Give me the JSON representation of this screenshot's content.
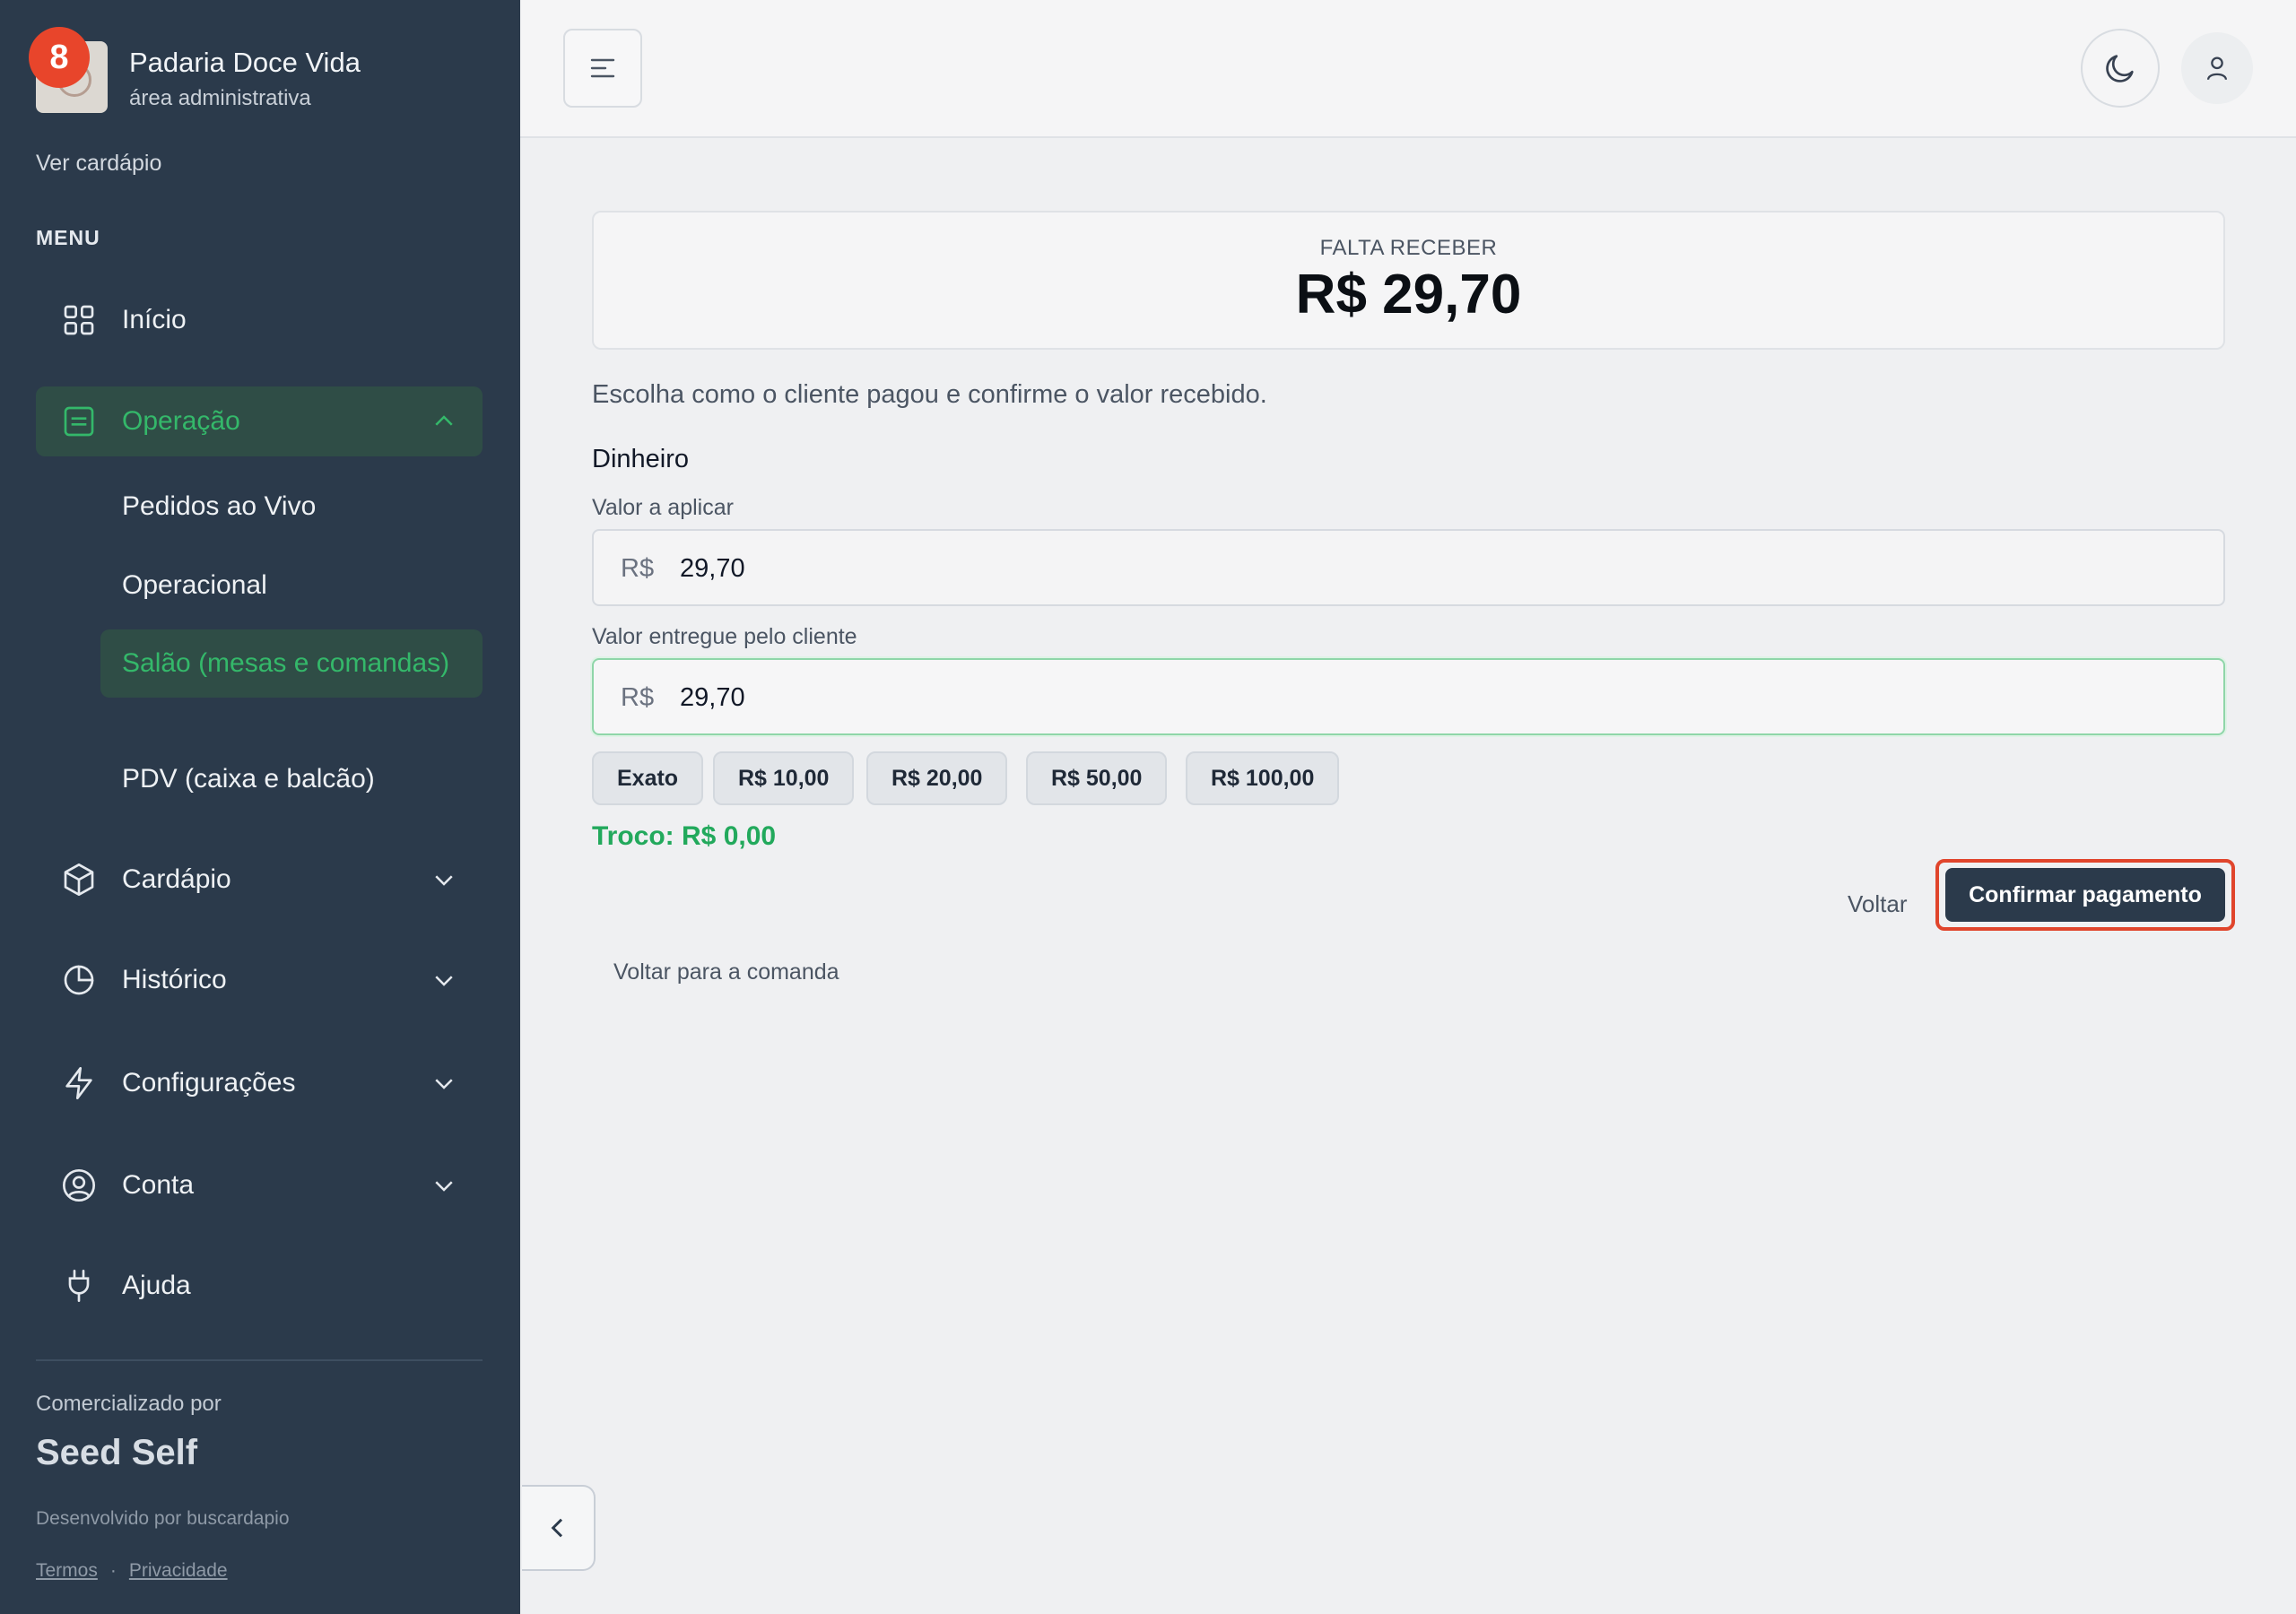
{
  "sidebar": {
    "notification_count": "8",
    "brand_name": "Padaria Doce Vida",
    "brand_subtitle": "área administrativa",
    "view_menu_link": "Ver cardápio",
    "menu_heading": "MENU",
    "items": [
      {
        "label": "Início",
        "icon": "grid-icon"
      },
      {
        "label": "Operação",
        "icon": "list-icon",
        "expanded": true
      },
      {
        "label": "Cardápio",
        "icon": "box-icon"
      },
      {
        "label": "Histórico",
        "icon": "pie-chart-icon"
      },
      {
        "label": "Configurações",
        "icon": "bolt-icon"
      },
      {
        "label": "Conta",
        "icon": "user-circle-icon"
      },
      {
        "label": "Ajuda",
        "icon": "plug-icon"
      }
    ],
    "operation_subitems": [
      {
        "label": "Pedidos ao Vivo"
      },
      {
        "label": "Operacional"
      },
      {
        "label": "Salão (mesas e comandas)",
        "active": true
      },
      {
        "label": "PDV (caixa e balcão)"
      }
    ],
    "marketed_by_label": "Comercializado por",
    "marketed_by_brand": "Seed Self",
    "developed_by": "Desenvolvido por buscardapio",
    "terms_link": "Termos",
    "separator": "·",
    "privacy_link": "Privacidade"
  },
  "payment": {
    "due_label": "FALTA RECEBER",
    "due_amount": "R$ 29,70",
    "instruction": "Escolha como o cliente pagou e confirme o valor recebido.",
    "method_title": "Dinheiro",
    "apply_label": "Valor a aplicar",
    "apply_currency": "R$",
    "apply_value": "29,70",
    "given_label": "Valor entregue pelo cliente",
    "given_currency": "R$",
    "given_value": "29,70",
    "quick_amounts": [
      "Exato",
      "R$ 10,00",
      "R$ 20,00",
      "R$ 50,00",
      "R$ 100,00"
    ],
    "change_label": "Troco:",
    "change_value": "R$ 0,00",
    "back_button": "Voltar",
    "confirm_button": "Confirmar pagamento",
    "back_to_tab_link": "Voltar para a comanda"
  },
  "colors": {
    "sidebar_bg": "#2b3a4b",
    "accent_green": "#22a95c",
    "badge_red": "#e8452b",
    "highlight_outline": "#e0452c",
    "primary_button": "#2b3a4b"
  }
}
